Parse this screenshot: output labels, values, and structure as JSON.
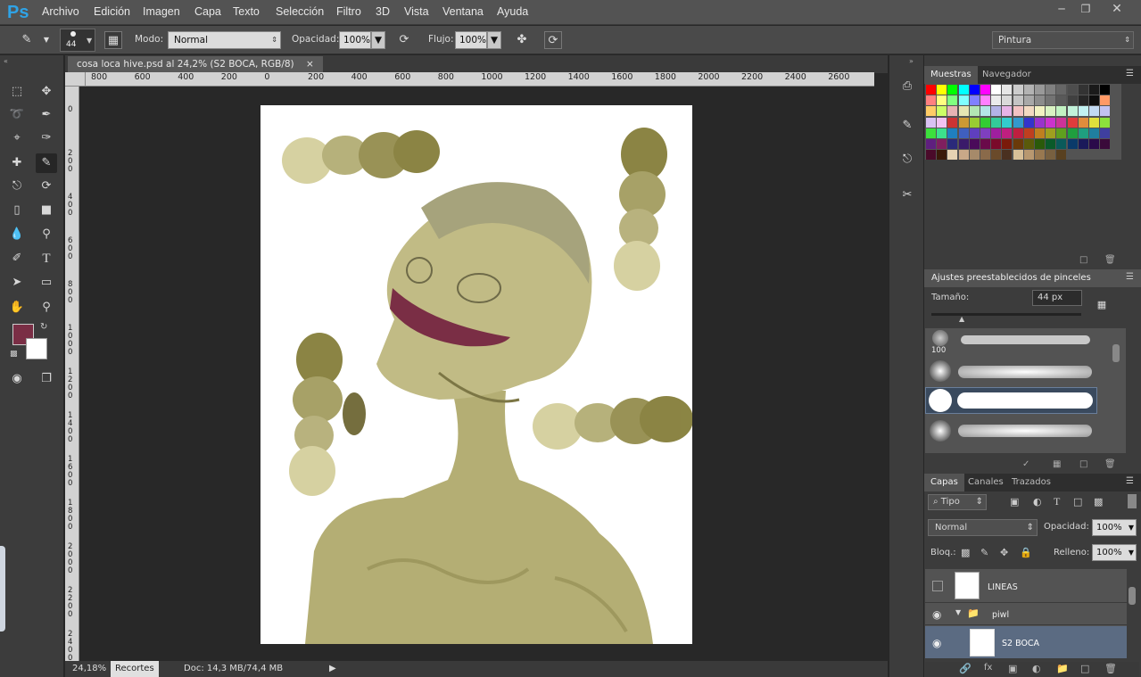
{
  "app": {
    "logo": "Ps",
    "brand_color": "#2fa3e6"
  },
  "menu": [
    "Archivo",
    "Edición",
    "Imagen",
    "Capa",
    "Texto",
    "Selección",
    "Filtro",
    "3D",
    "Vista",
    "Ventana",
    "Ayuda"
  ],
  "window_controls": [
    "minimize-icon",
    "restore-icon",
    "close-icon"
  ],
  "options": {
    "brush_size": "44",
    "mode_label": "Modo:",
    "mode_value": "Normal",
    "opacity_label": "Opacidad:",
    "opacity_value": "100%",
    "flow_label": "Flujo:",
    "flow_value": "100%",
    "workspace": "Pintura"
  },
  "document": {
    "tab_title": "cosa loca hive.psd al 24,2% (S2 BOCA, RGB/8)",
    "tab_close": "×",
    "zoom": "24,18%",
    "recortes_tab": "Recortes",
    "doc_size": "Doc: 14,3 MB/74,4 MB",
    "status_arrow": "▶"
  },
  "rulers": {
    "horizontal": [
      "800",
      "600",
      "400",
      "200",
      "0",
      "200",
      "400",
      "600",
      "800",
      "1000",
      "1200",
      "1400",
      "1600",
      "1800",
      "2000",
      "2200",
      "2400",
      "2600"
    ],
    "vertical": [
      "0",
      "200",
      "400",
      "600",
      "800",
      "1000",
      "1200",
      "1400",
      "1600",
      "1800",
      "2000",
      "2200",
      "2400"
    ]
  },
  "colors": {
    "foreground": "#7a2e45",
    "background": "#ffffff",
    "swatches": [
      "#ff0000",
      "#ffff00",
      "#00ff00",
      "#00ffff",
      "#0000ff",
      "#ff00ff",
      "#ffffff",
      "#e6e6e6",
      "#cccccc",
      "#b3b3b3",
      "#999999",
      "#808080",
      "#666666",
      "#4d4d4d",
      "#333333",
      "#1a1a1a",
      "#000000",
      "#ff8080",
      "#ffff80",
      "#80ff80",
      "#80ffff",
      "#8080ff",
      "#ff80ff",
      "#ebebeb",
      "#d9d9d9",
      "#c4c4c4",
      "#a8a8a8",
      "#8c8c8c",
      "#737373",
      "#595959",
      "#404040",
      "#262626",
      "#0d0d0d",
      "#ff9966",
      "#ffcc66",
      "#ccff66",
      "#e6b3b3",
      "#e6e6b3",
      "#b3e6b3",
      "#b3e6e6",
      "#b3b3e6",
      "#e6b3e6",
      "#f2c2c2",
      "#f2d9c2",
      "#f2f2c2",
      "#d9f2c2",
      "#c2f2c2",
      "#c2f2d9",
      "#c2f2f2",
      "#c2d9f2",
      "#c2c2f2",
      "#d9c2f2",
      "#f2c2f2",
      "#cc3333",
      "#cc9933",
      "#99cc33",
      "#33cc33",
      "#33cc99",
      "#33cccc",
      "#3399cc",
      "#3333cc",
      "#9933cc",
      "#cc33cc",
      "#cc3399",
      "#e03c3c",
      "#e08c3c",
      "#e0e03c",
      "#8ce03c",
      "#3ce03c",
      "#3ce08c",
      "#1f7fbf",
      "#3f5fbf",
      "#5f3fbf",
      "#7f3fbf",
      "#9f1f9f",
      "#bf1f7f",
      "#bf1f3f",
      "#bf3f1f",
      "#bf7f1f",
      "#9f9f1f",
      "#5f9f1f",
      "#1f9f3f",
      "#1f9f7f",
      "#1f7f9f",
      "#3f3f9f",
      "#5f1f7f",
      "#7f1f5f",
      "#2a2a7a",
      "#3a1a6a",
      "#4a0a5a",
      "#6a0a4a",
      "#7a0a2a",
      "#7a1a0a",
      "#6a3a0a",
      "#5a5a0a",
      "#2a5a0a",
      "#0a5a2a",
      "#0a5a5a",
      "#0a3a6a",
      "#1a1a5a",
      "#2a0a4a",
      "#3a0a3a",
      "#4a0a2a",
      "#3a1a0a",
      "#e6d3b3",
      "#c8a888",
      "#a68a6a",
      "#8a6a4a",
      "#6a4a2a",
      "#4a3020",
      "#d8c098",
      "#b89870",
      "#987850",
      "#786040",
      "#584020"
    ]
  },
  "panels": {
    "swatch_tabs": [
      "Muestras",
      "Navegador"
    ],
    "brush_presets_title": "Ajustes preestablecidos de pinceles",
    "size_label": "Tamaño:",
    "size_value": "44 px",
    "brush_count": "100",
    "layer_tabs": [
      "Capas",
      "Canales",
      "Trazados"
    ],
    "filter_kind": "Tipo",
    "blend_mode": "Normal",
    "layer_opacity_label": "Opacidad:",
    "layer_opacity_value": "100%",
    "lock_label": "Bloq.:",
    "fill_label": "Relleno:",
    "fill_value": "100%",
    "layers": [
      {
        "name": "LINEAS",
        "visible": false
      },
      {
        "name": "piwl",
        "visible": true
      },
      {
        "name": "S2 BOCA",
        "visible": true
      }
    ]
  }
}
